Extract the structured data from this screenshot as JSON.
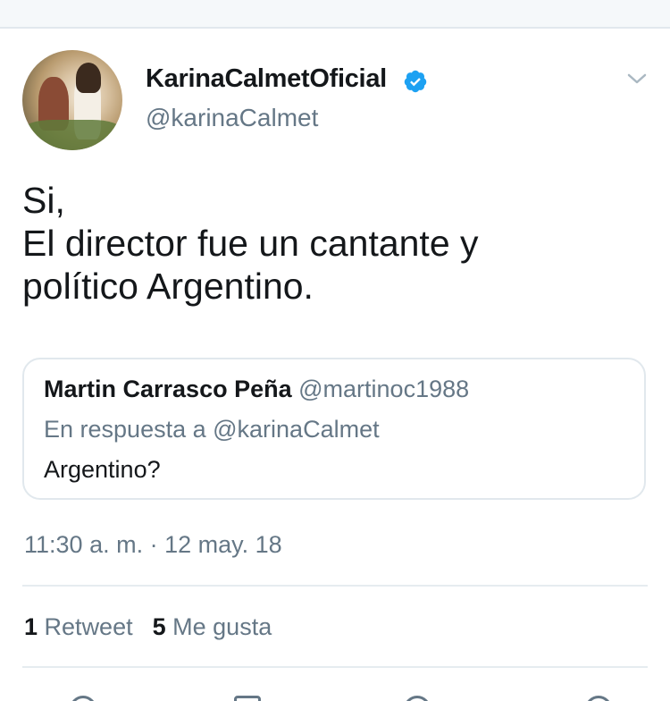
{
  "tweet": {
    "display_name": "KarinaCalmetOficial",
    "handle": "@karinaCalmet",
    "verified_icon": "verified-badge-icon",
    "menu_icon": "chevron-down-icon",
    "text_lines": [
      "Si,",
      "El director fue un cantante y",
      "político Argentino."
    ],
    "timestamp": "11:30 a. m. · 12 may. 18"
  },
  "quoted": {
    "name": "Martin Carrasco Peña",
    "handle": "@martinoc1988",
    "reply_to": "En respuesta a @karinaCalmet",
    "text": "Argentino?"
  },
  "stats": {
    "retweets_count": "1",
    "retweets_label": "Retweet",
    "likes_count": "5",
    "likes_label": "Me gusta"
  },
  "actions": [
    "reply-icon",
    "retweet-icon",
    "like-icon",
    "share-icon"
  ],
  "colors": {
    "verified": "#1da1f2",
    "secondary_text": "#657786",
    "primary_text": "#14171a",
    "border": "#e1e8ed"
  }
}
